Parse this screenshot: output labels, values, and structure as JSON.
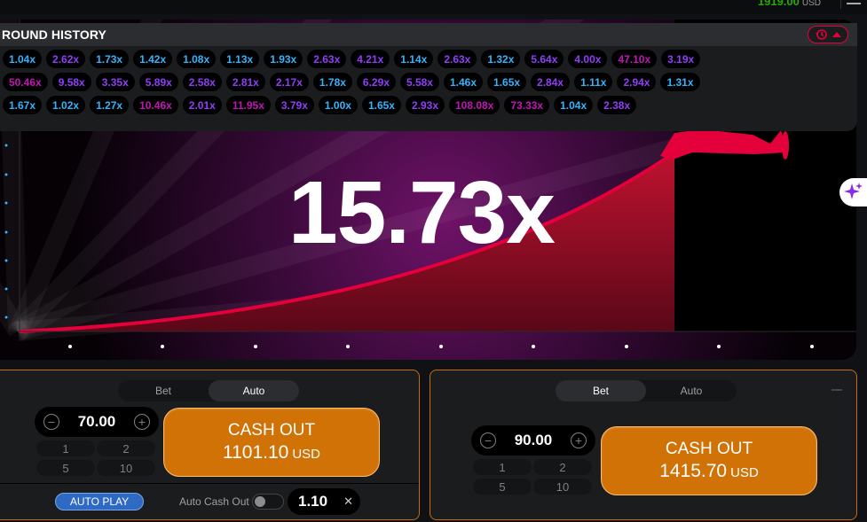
{
  "header": {
    "balance_partial": "1919.00",
    "currency": "USD",
    "menu_icon": "hamburger-icon"
  },
  "history": {
    "title": "ROUND HISTORY",
    "toggle_icons": [
      "history-icon",
      "caret-up-icon"
    ],
    "rows": [
      [
        {
          "v": "1.04x",
          "c": "blue"
        },
        {
          "v": "2.62x",
          "c": "purple"
        },
        {
          "v": "1.73x",
          "c": "blue"
        },
        {
          "v": "1.42x",
          "c": "blue"
        },
        {
          "v": "1.08x",
          "c": "blue"
        },
        {
          "v": "1.13x",
          "c": "blue"
        },
        {
          "v": "1.93x",
          "c": "blue"
        },
        {
          "v": "2.63x",
          "c": "purple"
        },
        {
          "v": "4.21x",
          "c": "purple"
        },
        {
          "v": "1.14x",
          "c": "blue"
        },
        {
          "v": "2.63x",
          "c": "purple"
        },
        {
          "v": "1.32x",
          "c": "blue"
        },
        {
          "v": "5.64x",
          "c": "purple"
        },
        {
          "v": "4.00x",
          "c": "purple"
        },
        {
          "v": "47.10x",
          "c": "pink"
        },
        {
          "v": "3.19x",
          "c": "purple"
        }
      ],
      [
        {
          "v": "50.46x",
          "c": "pink"
        },
        {
          "v": "9.58x",
          "c": "purple"
        },
        {
          "v": "3.35x",
          "c": "purple"
        },
        {
          "v": "5.89x",
          "c": "purple"
        },
        {
          "v": "2.58x",
          "c": "purple"
        },
        {
          "v": "2.81x",
          "c": "purple"
        },
        {
          "v": "2.17x",
          "c": "purple"
        },
        {
          "v": "1.78x",
          "c": "blue"
        },
        {
          "v": "6.29x",
          "c": "purple"
        },
        {
          "v": "5.58x",
          "c": "purple"
        },
        {
          "v": "1.46x",
          "c": "blue"
        },
        {
          "v": "1.65x",
          "c": "blue"
        },
        {
          "v": "2.84x",
          "c": "purple"
        },
        {
          "v": "1.11x",
          "c": "blue"
        },
        {
          "v": "2.94x",
          "c": "purple"
        },
        {
          "v": "1.31x",
          "c": "blue"
        }
      ],
      [
        {
          "v": "1.67x",
          "c": "blue"
        },
        {
          "v": "1.02x",
          "c": "blue"
        },
        {
          "v": "1.27x",
          "c": "blue"
        },
        {
          "v": "10.46x",
          "c": "pink"
        },
        {
          "v": "2.01x",
          "c": "purple"
        },
        {
          "v": "11.95x",
          "c": "pink"
        },
        {
          "v": "3.79x",
          "c": "purple"
        },
        {
          "v": "1.00x",
          "c": "blue"
        },
        {
          "v": "1.65x",
          "c": "blue"
        },
        {
          "v": "2.93x",
          "c": "purple"
        },
        {
          "v": "108.08x",
          "c": "pink"
        },
        {
          "v": "73.33x",
          "c": "pink"
        },
        {
          "v": "1.04x",
          "c": "blue"
        },
        {
          "v": "2.38x",
          "c": "purple"
        }
      ]
    ]
  },
  "game": {
    "multiplier": "15.73x",
    "plane_icon": "plane-icon",
    "side_icon": "sparkle-icon"
  },
  "colors": {
    "accent": "#e4003b",
    "cashout": "#d07206",
    "blue": "#34b4ff",
    "purple": "#913ef8",
    "pink": "#c017b4"
  },
  "bet_panels": [
    {
      "tabs": [
        "Bet",
        "Auto"
      ],
      "active_tab": "Auto",
      "amount": "70.00",
      "quick": [
        "1",
        "2",
        "5",
        "10"
      ],
      "cashout_label": "CASH OUT",
      "cashout_amount": "1101.10",
      "cashout_currency": "USD",
      "autoplay_label": "AUTO PLAY",
      "auto_cashout_label": "Auto Cash Out",
      "auto_cashout_value": "1.10",
      "auto_cashout_enabled": false
    },
    {
      "tabs": [
        "Bet",
        "Auto"
      ],
      "active_tab": "Bet",
      "amount": "90.00",
      "quick": [
        "1",
        "2",
        "5",
        "10"
      ],
      "cashout_label": "CASH OUT",
      "cashout_amount": "1415.70",
      "cashout_currency": "USD"
    }
  ]
}
